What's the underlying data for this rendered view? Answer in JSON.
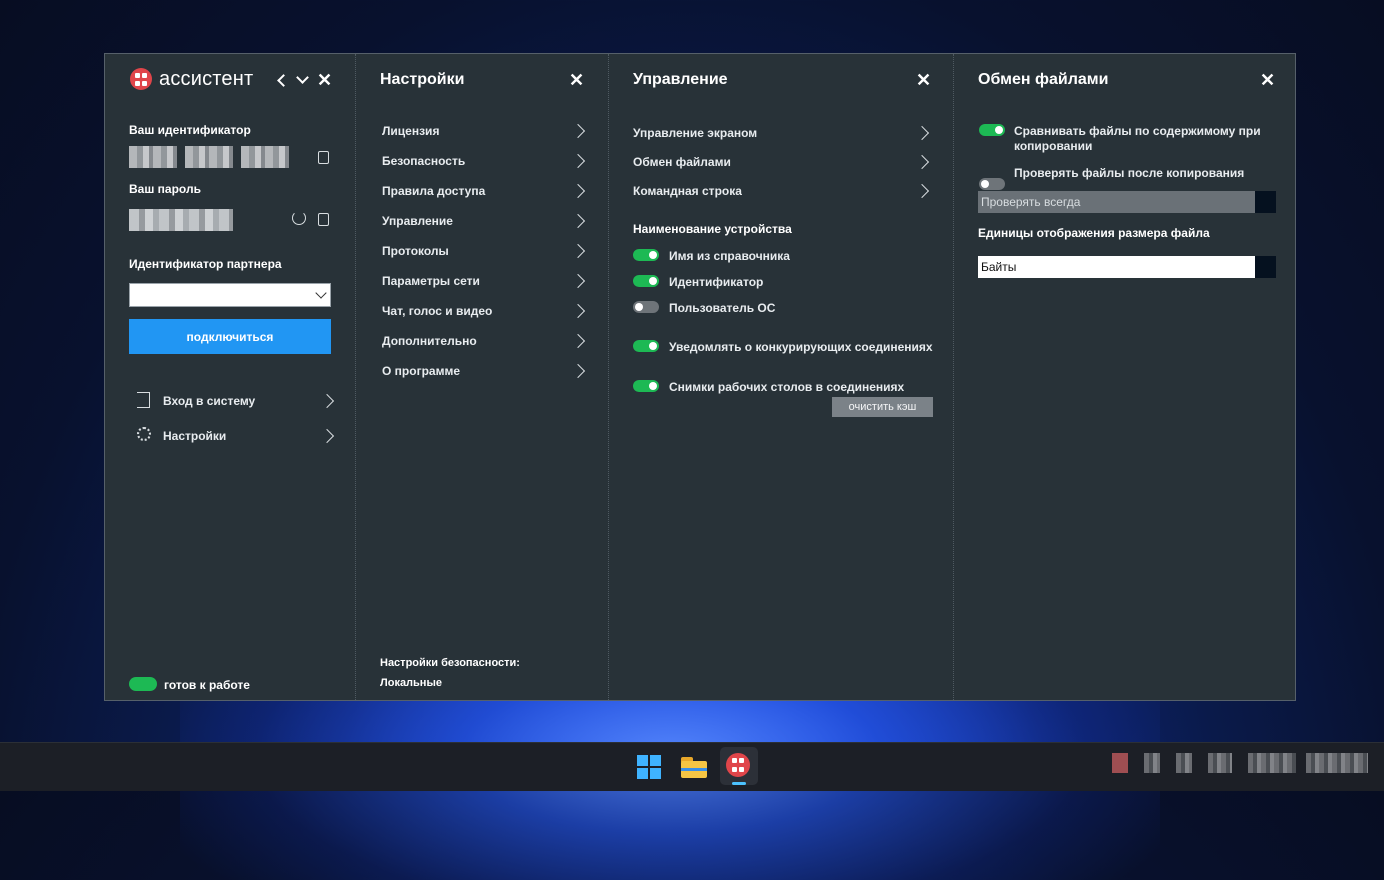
{
  "app": {
    "brand": "ассистент",
    "your_id_label": "Ваш идентификатор",
    "your_password_label": "Ваш пароль",
    "partner_id_label": "Идентификатор партнера",
    "connect_button": "подключиться",
    "login_item": "Вход в систему",
    "settings_item": "Настройки",
    "status_text": "готов к работе"
  },
  "settings": {
    "title": "Настройки",
    "items": [
      {
        "label": "Лицензия"
      },
      {
        "label": "Безопасность"
      },
      {
        "label": "Правила доступа"
      },
      {
        "label": "Управление"
      },
      {
        "label": "Протоколы"
      },
      {
        "label": "Параметры сети"
      },
      {
        "label": "Чат, голос и видео"
      },
      {
        "label": "Дополнительно"
      },
      {
        "label": "О программе"
      }
    ],
    "security_label": "Настройки безопасности:",
    "security_value": "Локальные"
  },
  "control": {
    "title": "Управление",
    "items": [
      {
        "label": "Управление экраном"
      },
      {
        "label": "Обмен файлами"
      },
      {
        "label": "Командная строка"
      }
    ],
    "device_name_label": "Наименование устройства",
    "toggles": [
      {
        "label": "Имя из справочника",
        "on": true
      },
      {
        "label": "Идентификатор",
        "on": true
      },
      {
        "label": "Пользователь ОС",
        "on": false
      }
    ],
    "notify_label": "Уведомлять о конкурирующих соединениях",
    "notify_on": true,
    "snapshots_label": "Снимки рабочих столов в соединениях",
    "snapshots_on": true,
    "clear_cache_button": "очистить кэш"
  },
  "files": {
    "title": "Обмен файлами",
    "compare_label_line1": "Сравнивать файлы по содержимому при",
    "compare_label_line2": "копировании",
    "compare_on": true,
    "verify_label": "Проверять файлы после копирования",
    "verify_on": false,
    "verify_mode_value": "Проверять всегда",
    "size_units_label": "Единицы отображения размера файла",
    "size_units_value": "Байты"
  },
  "colors": {
    "accent": "#2196f3",
    "toggle_on": "#1db954",
    "logo": "#e0454a",
    "window_bg": "#283238"
  }
}
